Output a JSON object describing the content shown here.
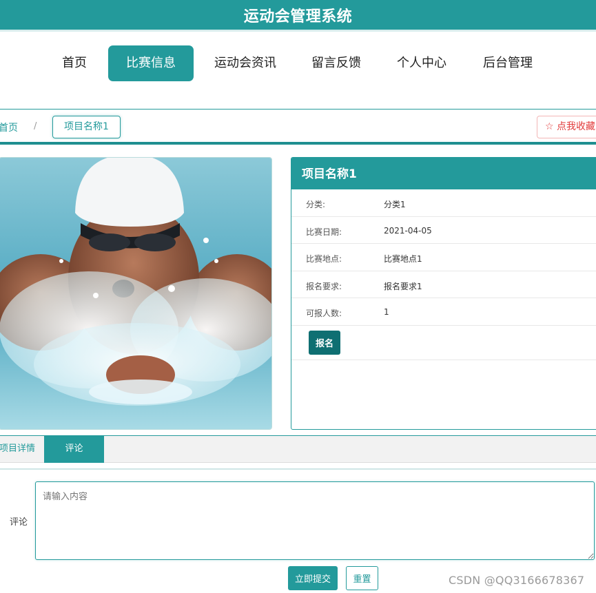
{
  "app": {
    "title": "运动会管理系统"
  },
  "nav": {
    "items": [
      {
        "label": "首页"
      },
      {
        "label": "比赛信息"
      },
      {
        "label": "运动会资讯"
      },
      {
        "label": "留言反馈"
      },
      {
        "label": "个人中心"
      },
      {
        "label": "后台管理"
      }
    ],
    "active_index": 1
  },
  "breadcrumb": {
    "home": "首页",
    "separator": "/",
    "current": "项目名称1"
  },
  "favorite": {
    "icon": "star-outline-icon",
    "label": "☆ 点我收藏"
  },
  "detail": {
    "title": "项目名称1",
    "rows": [
      {
        "label": "分类:",
        "value": "分类1"
      },
      {
        "label": "比赛日期:",
        "value": "2021-04-05"
      },
      {
        "label": "比赛地点:",
        "value": "比赛地点1"
      },
      {
        "label": "报名要求:",
        "value": "报名要求1"
      },
      {
        "label": "可报人数:",
        "value": "1"
      }
    ],
    "signup_label": "报名"
  },
  "tabs": [
    {
      "label": "项目详情"
    },
    {
      "label": "评论"
    }
  ],
  "comment": {
    "label": "评论",
    "placeholder": "请输入内容",
    "submit_label": "立即提交",
    "reset_label": "重置"
  },
  "watermark": "CSDN @QQ3166678367",
  "colors": {
    "accent": "#239a9b",
    "accent_dark": "#0f6f72",
    "favorite": "#e23a3a"
  }
}
